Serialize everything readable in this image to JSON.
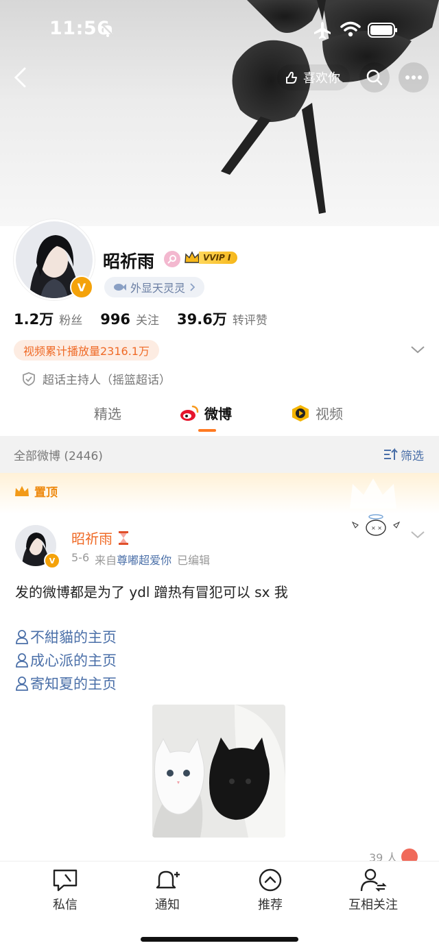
{
  "status": {
    "time": "11:56"
  },
  "header": {
    "like_label": "喜欢你"
  },
  "profile": {
    "name": "昭祈雨",
    "vip_badge": "VVIP I",
    "tag": "外显天灵灵",
    "stats": [
      {
        "num": "1.2万",
        "label": "粉丝"
      },
      {
        "num": "996",
        "label": "关注"
      },
      {
        "num": "39.6万",
        "label": "转评赞"
      }
    ],
    "video_plays": "视频累计播放量2316.1万",
    "host_line": "超话主持人（摇篮超话）"
  },
  "tabs": [
    {
      "label": "精选"
    },
    {
      "label": "微博"
    },
    {
      "label": "视频"
    }
  ],
  "filter": {
    "all_label": "全部微博 (2446)",
    "filter_label": "筛选"
  },
  "pinned": {
    "label": "置顶"
  },
  "post": {
    "author": "昭祈雨",
    "date": "5-6",
    "source_prefix": "来自",
    "source": "尊嘟超爱你",
    "edited": "已编辑",
    "text": "发的微博都是为了 ydl 蹭热有冒犯可以 sx 我",
    "mentions": [
      "不紺貓的主页",
      "成心派的主页",
      "寄知夏的主页"
    ],
    "reaction_count": "39 人"
  },
  "bottom_bar": [
    {
      "label": "私信",
      "icon": "message-icon"
    },
    {
      "label": "通知",
      "icon": "bell-plus-icon"
    },
    {
      "label": "推荐",
      "icon": "chevron-up-circle-icon"
    },
    {
      "label": "互相关注",
      "icon": "mutual-follow-icon"
    }
  ],
  "colors": {
    "accent": "#ff7a22",
    "link": "#4a6fa8",
    "vip_gold": "#f4a20a"
  }
}
